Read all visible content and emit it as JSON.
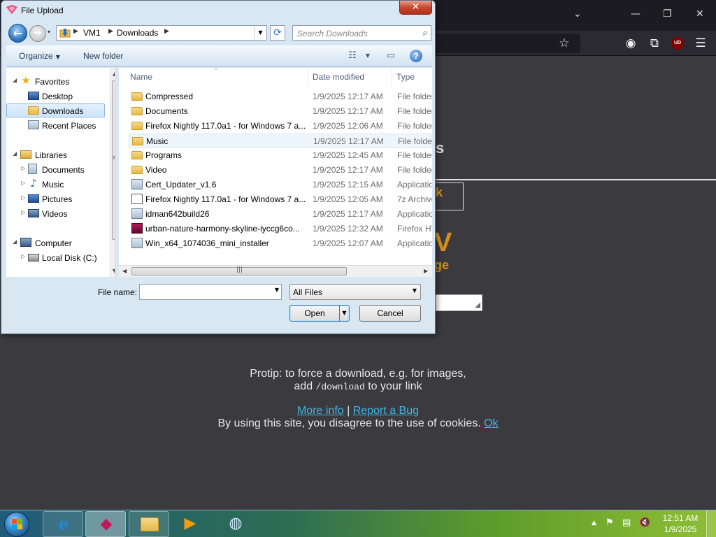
{
  "colors": {
    "page_bg": "#3b3b3f",
    "link": "#3fb5e8",
    "accent_orange": "#d4901e",
    "dialog_frame": "#d9e7f3",
    "close_red": "#c7482f"
  },
  "browser": {
    "window_controls": [
      "⌄",
      "—",
      "❐",
      "✕"
    ],
    "toolbar_icons": [
      "bookmark-star-icon",
      "account-icon",
      "extensions-icon",
      "ublock-icon",
      "menu-icon"
    ],
    "ublock_badge": "UD",
    "page": {
      "fragments": [
        "s",
        "k",
        "V",
        "ge"
      ],
      "protip_line1": "Protip: to force a download, e.g. for images,",
      "protip_line2_pre": "add",
      "protip_code": "/download",
      "protip_line2_post": "to your link",
      "more_info": "More info",
      "separator": "|",
      "report_bug": "Report a Bug",
      "cookie_text": "By using this site, you disagree to the use of cookies.",
      "ok": "Ok"
    }
  },
  "dialog": {
    "title": "File Upload",
    "close_glyph": "✕",
    "address": {
      "crumbs": [
        "VM1",
        "Downloads"
      ]
    },
    "search_placeholder": "Search Downloads",
    "commands": {
      "organize": "Organize",
      "new_folder": "New folder"
    },
    "nav": {
      "favorites": "Favorites",
      "desktop": "Desktop",
      "downloads": "Downloads",
      "recent_places": "Recent Places",
      "libraries": "Libraries",
      "documents": "Documents",
      "music": "Music",
      "pictures": "Pictures",
      "videos": "Videos",
      "computer": "Computer",
      "local_disk": "Local Disk (C:)"
    },
    "columns": {
      "name": "Name",
      "date_modified": "Date modified",
      "type": "Type"
    },
    "files": [
      {
        "name": "Compressed",
        "date": "1/9/2025 12:17 AM",
        "type": "File folder",
        "icon": "folder-icon"
      },
      {
        "name": "Documents",
        "date": "1/9/2025 12:17 AM",
        "type": "File folder",
        "icon": "folder-icon"
      },
      {
        "name": "Firefox Nightly 117.0a1 - for Windows 7 a...",
        "date": "1/9/2025 12:06 AM",
        "type": "File folder",
        "icon": "folder-icon"
      },
      {
        "name": "Music",
        "date": "1/9/2025 12:17 AM",
        "type": "File folder",
        "icon": "folder-icon"
      },
      {
        "name": "Programs",
        "date": "1/9/2025 12:45 AM",
        "type": "File folder",
        "icon": "folder-icon"
      },
      {
        "name": "Video",
        "date": "1/9/2025 12:17 AM",
        "type": "File folder",
        "icon": "folder-icon"
      },
      {
        "name": "Cert_Updater_v1.6",
        "date": "1/9/2025 12:15 AM",
        "type": "Application",
        "icon": "application-icon"
      },
      {
        "name": "Firefox Nightly 117.0a1 - for Windows 7 a...",
        "date": "1/9/2025 12:05 AM",
        "type": "7z Archive",
        "icon": "archive-icon"
      },
      {
        "name": "idman642build26",
        "date": "1/9/2025 12:17 AM",
        "type": "Application",
        "icon": "application-icon"
      },
      {
        "name": "urban-nature-harmony-skyline-iyccg6co...",
        "date": "1/9/2025 12:32 AM",
        "type": "Firefox HTML",
        "icon": "html-file-icon"
      },
      {
        "name": "Win_x64_1074036_mini_installer",
        "date": "1/9/2025 12:07 AM",
        "type": "Application",
        "icon": "installer-icon"
      }
    ],
    "file_name_label": "File name:",
    "file_name_value": "",
    "filter_value": "All Files",
    "open_label": "Open",
    "cancel_label": "Cancel"
  },
  "taskbar": {
    "apps": [
      "internet-explorer-icon",
      "firefox-nightly-icon",
      "file-explorer-icon",
      "media-player-icon",
      "network-app-icon"
    ],
    "tray_arrow": "▲",
    "clock_time": "12:51 AM",
    "clock_date": "1/9/2025"
  }
}
